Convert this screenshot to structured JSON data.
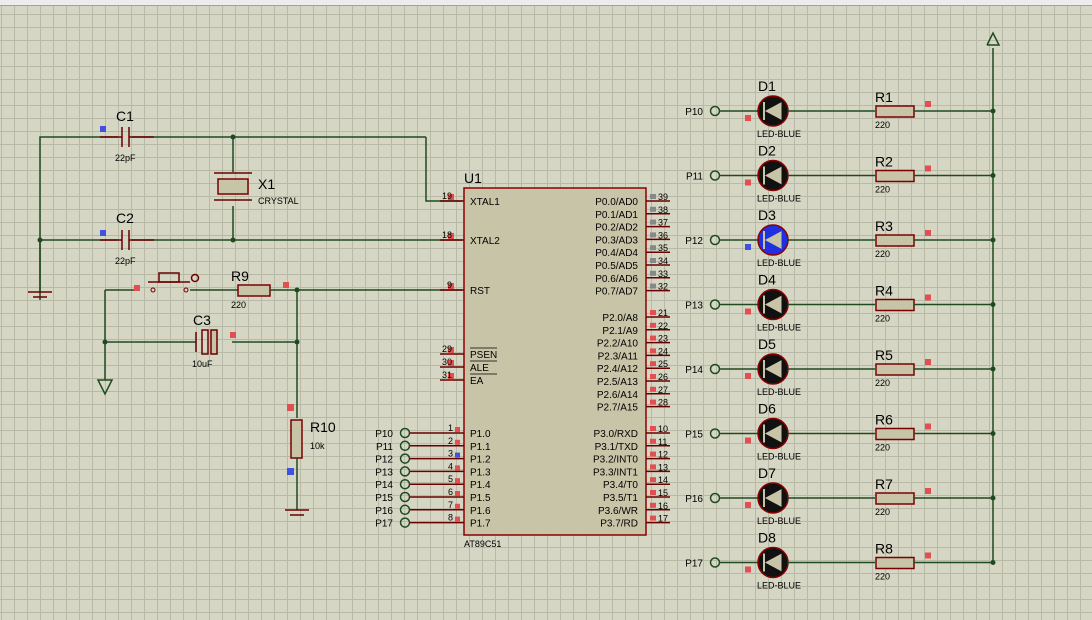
{
  "crystal_section": {
    "c1": {
      "ref": "C1",
      "value": "22pF"
    },
    "c2": {
      "ref": "C2",
      "value": "22pF"
    },
    "x1": {
      "ref": "X1",
      "value": "CRYSTAL"
    },
    "r9": {
      "ref": "R9",
      "value": "220"
    },
    "c3": {
      "ref": "C3",
      "value": "10uF"
    },
    "r10": {
      "ref": "R10",
      "value": "10k"
    }
  },
  "mcu": {
    "ref": "U1",
    "part": "AT89C51",
    "left_pins": [
      {
        "num": "19",
        "name": "XTAL1"
      },
      {
        "num": "18",
        "name": "XTAL2"
      },
      {
        "num": "9",
        "name": "RST"
      },
      {
        "num": "29",
        "name": "PSEN"
      },
      {
        "num": "30",
        "name": "ALE"
      },
      {
        "num": "31",
        "name": "EA"
      }
    ],
    "p1_pins": [
      {
        "num": "1",
        "name": "P1.0",
        "label": "P10"
      },
      {
        "num": "2",
        "name": "P1.1",
        "label": "P11"
      },
      {
        "num": "3",
        "name": "P1.2",
        "label": "P12"
      },
      {
        "num": "4",
        "name": "P1.3",
        "label": "P13"
      },
      {
        "num": "5",
        "name": "P1.4",
        "label": "P14"
      },
      {
        "num": "6",
        "name": "P1.5",
        "label": "P15"
      },
      {
        "num": "7",
        "name": "P1.6",
        "label": "P16"
      },
      {
        "num": "8",
        "name": "P1.7",
        "label": "P17"
      }
    ],
    "p0_pins": [
      {
        "num": "39",
        "name": "P0.0/AD0"
      },
      {
        "num": "38",
        "name": "P0.1/AD1"
      },
      {
        "num": "37",
        "name": "P0.2/AD2"
      },
      {
        "num": "36",
        "name": "P0.3/AD3"
      },
      {
        "num": "35",
        "name": "P0.4/AD4"
      },
      {
        "num": "34",
        "name": "P0.5/AD5"
      },
      {
        "num": "33",
        "name": "P0.6/AD6"
      },
      {
        "num": "32",
        "name": "P0.7/AD7"
      }
    ],
    "p2_pins": [
      {
        "num": "21",
        "name": "P2.0/A8"
      },
      {
        "num": "22",
        "name": "P2.1/A9"
      },
      {
        "num": "23",
        "name": "P2.2/A10"
      },
      {
        "num": "24",
        "name": "P2.3/A11"
      },
      {
        "num": "25",
        "name": "P2.4/A12"
      },
      {
        "num": "26",
        "name": "P2.5/A13"
      },
      {
        "num": "27",
        "name": "P2.6/A14"
      },
      {
        "num": "28",
        "name": "P2.7/A15"
      }
    ],
    "p3_pins": [
      {
        "num": "10",
        "name": "P3.0/RXD"
      },
      {
        "num": "11",
        "name": "P3.1/TXD"
      },
      {
        "num": "12",
        "name": "P3.2/INT0"
      },
      {
        "num": "13",
        "name": "P3.3/INT1"
      },
      {
        "num": "14",
        "name": "P3.4/T0"
      },
      {
        "num": "15",
        "name": "P3.5/T1"
      },
      {
        "num": "16",
        "name": "P3.6/WR"
      },
      {
        "num": "17",
        "name": "P3.7/RD"
      }
    ]
  },
  "leds": [
    {
      "ref": "D1",
      "part": "LED-BLUE",
      "net": "P10",
      "res": "R1",
      "res_val": "220",
      "lit": false
    },
    {
      "ref": "D2",
      "part": "LED-BLUE",
      "net": "P11",
      "res": "R2",
      "res_val": "220",
      "lit": false
    },
    {
      "ref": "D3",
      "part": "LED-BLUE",
      "net": "P12",
      "res": "R3",
      "res_val": "220",
      "lit": true
    },
    {
      "ref": "D4",
      "part": "LED-BLUE",
      "net": "P13",
      "res": "R4",
      "res_val": "220",
      "lit": false
    },
    {
      "ref": "D5",
      "part": "LED-BLUE",
      "net": "P14",
      "res": "R5",
      "res_val": "220",
      "lit": false
    },
    {
      "ref": "D6",
      "part": "LED-BLUE",
      "net": "P15",
      "res": "R6",
      "res_val": "220",
      "lit": false
    },
    {
      "ref": "D7",
      "part": "LED-BLUE",
      "net": "P16",
      "res": "R7",
      "res_val": "220",
      "lit": false
    },
    {
      "ref": "D8",
      "part": "LED-BLUE",
      "net": "P17",
      "res": "R8",
      "res_val": "220",
      "lit": false
    }
  ],
  "colors": {
    "led_lit": "#2030e0",
    "led_off": "#111111",
    "wire": "#1f4a1f",
    "component": "#8b0000",
    "body_fill": "#c8c4a8"
  }
}
